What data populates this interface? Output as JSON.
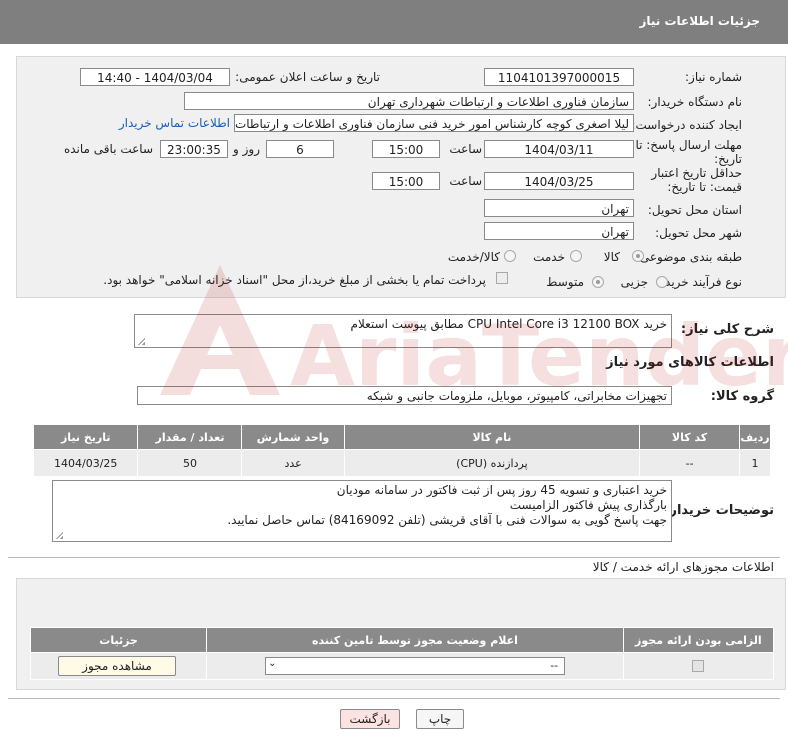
{
  "header": {
    "title": "جزئیات اطلاعات نیاز"
  },
  "form": {
    "need_number_label": "شماره نیاز:",
    "need_number": "1104101397000015",
    "announce_label": "تاریخ و ساعت اعلان عمومی:",
    "announce_value": "1404/03/04 - 14:40",
    "buyer_org_label": "نام دستگاه خریدار:",
    "buyer_org": "سازمان فناوری اطلاعات و ارتباطات شهرداری تهران",
    "creator_label": "ایجاد کننده درخواست:",
    "creator": "لیلا اصغری کوچه کارشناس امور خرید فنی سازمان فناوری اطلاعات و ارتباطات شهرداری تهران",
    "contact_link": "اطلاعات تماس خریدار",
    "deadline_label": "مهلت ارسال پاسخ: تا تاریخ:",
    "deadline_date": "1404/03/11",
    "time_label": "ساعت",
    "deadline_time": "15:00",
    "days_value": "6",
    "days_label": "روز و",
    "remaining_time": "23:00:35",
    "remaining_label": "ساعت باقی مانده",
    "price_validity_label": "حداقل تاریخ اعتبار قیمت: تا تاریخ:",
    "price_date": "1404/03/25",
    "price_time": "15:00",
    "province_label": "استان محل تحویل:",
    "province": "تهران",
    "city_label": "شهر محل تحویل:",
    "city": "تهران",
    "category_label": "طبقه بندی موضوعی:",
    "cat_goods": "کالا",
    "cat_service": "خدمت",
    "cat_goods_service": "کالا/خدمت",
    "process_label": "نوع فرآیند خرید :",
    "proc_partial": "جزیی",
    "proc_medium": "متوسط",
    "payment_note": "پرداخت تمام یا بخشی از مبلغ خرید،از محل \"اسناد خزانه اسلامی\" خواهد بود."
  },
  "summary": {
    "label": "شرح کلی نیاز:",
    "value": "خرید CPU Intel Core i3 12100 BOX مطابق پیوست استعلام"
  },
  "goods_section_title": "اطلاعات کالاهای مورد نیاز",
  "goods_group": {
    "label": "گروه کالا:",
    "value": "تجهیزات مخابراتی، کامپیوتر، موبایل، ملزومات جانبی و شبکه"
  },
  "goods_table": {
    "headers": [
      "ردیف",
      "کد کالا",
      "نام کالا",
      "واحد شمارش",
      "تعداد / مقدار",
      "تاریخ نیاز"
    ],
    "rows": [
      {
        "row": "1",
        "code": "--",
        "name": "پردازنده (CPU)",
        "unit": "عدد",
        "qty": "50",
        "date": "1404/03/25"
      }
    ]
  },
  "buyer_notes": {
    "label": "توضیحات خریدار:",
    "lines": [
      "خرید اعتباری و تسویه 45 روز پس از ثبت فاکتور در سامانه مودیان",
      "بارگذاری پیش فاکتور الزامیست",
      "جهت پاسخ گویی به سوالات فنی با آقای قریشی (تلفن 84169092) تماس حاصل نمایید."
    ]
  },
  "permits": {
    "title": "اطلاعات مجوزهای ارائه خدمت / کالا",
    "headers": [
      "الزامی بودن ارائه مجوز",
      "اعلام وضعیت مجوز توسط تامین کننده",
      "جزئیات"
    ],
    "select_value": "--",
    "view_button": "مشاهده مجوز"
  },
  "footer": {
    "print_button": "چاپ",
    "back_button": "بازگشت"
  },
  "watermark": {
    "text": "AriaTender.neT"
  },
  "colors": {
    "header_bg": "#7f7f7f",
    "panel_bg": "#f0f0f0",
    "table_header_bg": "#8a8a8a",
    "link": "#1a5fb4",
    "back_button_bg": "#fde2e2"
  }
}
